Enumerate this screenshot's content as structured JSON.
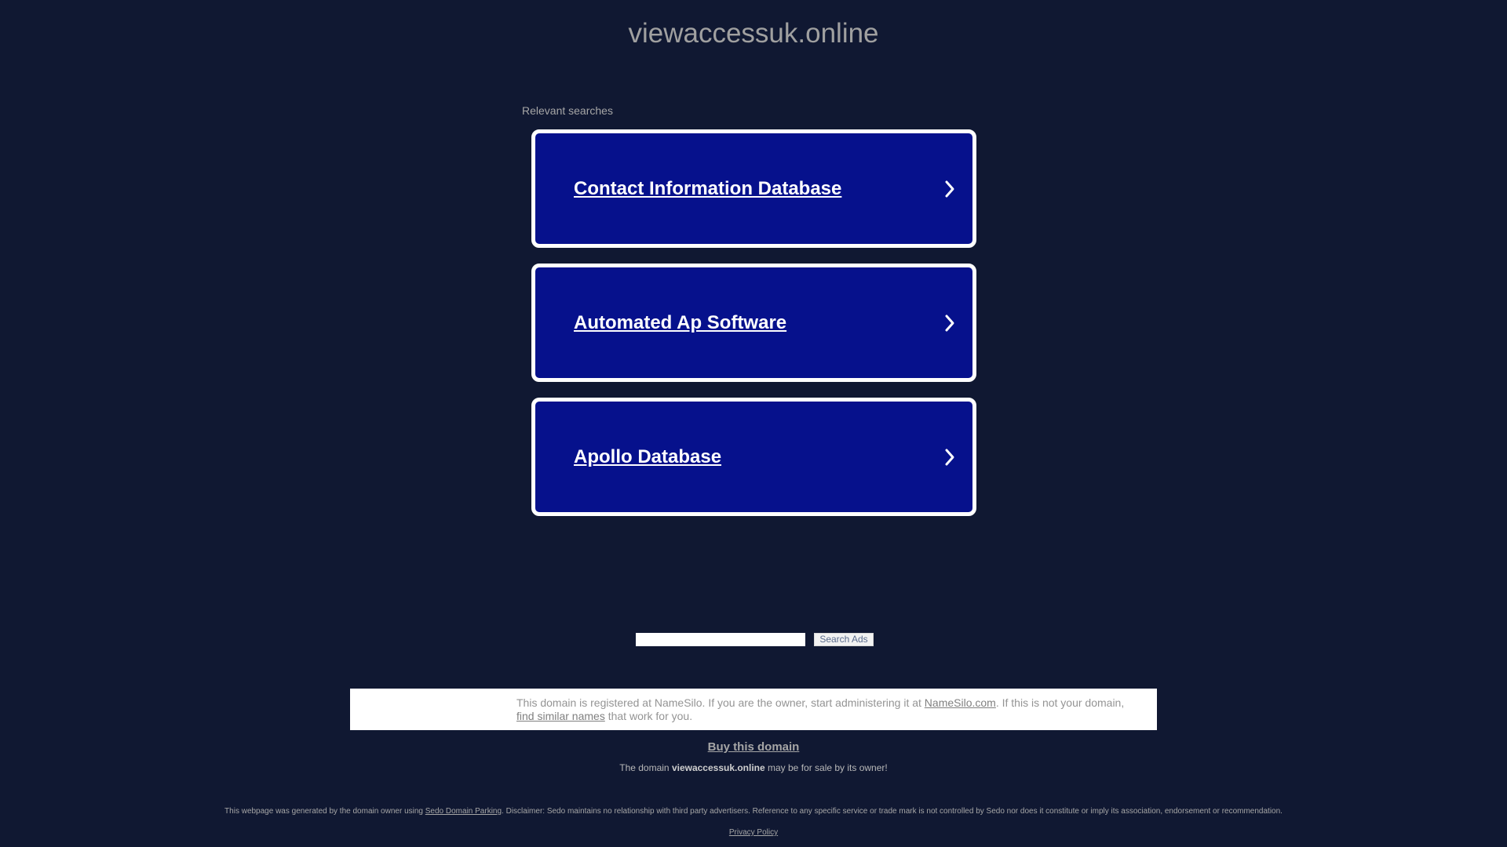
{
  "header": {
    "domain": "viewaccessuk.online"
  },
  "relevant_searches": {
    "label": "Relevant searches",
    "items": [
      {
        "label": "Contact Information Database"
      },
      {
        "label": "Automated Ap Software"
      },
      {
        "label": "Apollo Database"
      }
    ]
  },
  "search": {
    "input_value": "",
    "button_label": "Search Ads"
  },
  "info_box": {
    "text_1": "This domain is registered at NameSilo. If you are the owner, start administering it at ",
    "link_namesilo": "NameSilo.com",
    "text_2": ". If this is not your domain, ",
    "link_similar": "find similar names",
    "text_3": " that work for you."
  },
  "sale": {
    "buy_label": "Buy this domain",
    "prefix": "The domain ",
    "domain": "viewaccessuk.online",
    "suffix": " may be for sale by its owner!"
  },
  "footer": {
    "disclaimer_prefix": "This webpage was generated by the domain owner using ",
    "disclaimer_link": "Sedo Domain Parking",
    "disclaimer_suffix": ". Disclaimer: Sedo maintains no relationship with third party advertisers. Reference to any specific service or trade mark is not controlled by Sedo nor does it constitute or imply its association, endorsement or recommendation.",
    "privacy_label": "Privacy Policy"
  },
  "colors": {
    "background": "#101832",
    "card_bg": "#06118c",
    "card_border": "#ffffff"
  },
  "icons": {
    "card_arrow": "chevron-right-icon"
  }
}
